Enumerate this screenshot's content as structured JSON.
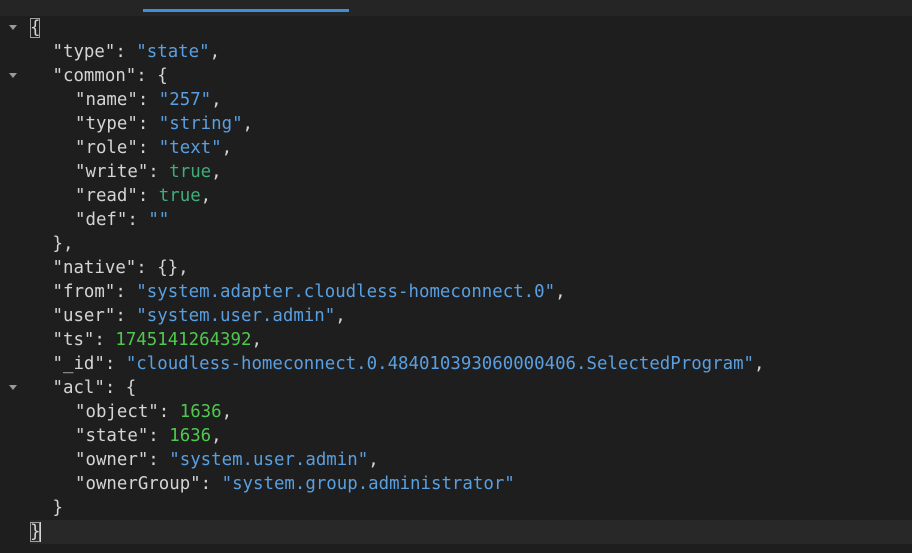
{
  "json_lines": [
    {
      "parts": [
        {
          "t": "{",
          "c": "punc"
        }
      ]
    },
    {
      "indent": 1,
      "parts": [
        {
          "t": "\"type\"",
          "c": "key"
        },
        {
          "t": ": ",
          "c": "punc"
        },
        {
          "t": "\"state\"",
          "c": "str"
        },
        {
          "t": ",",
          "c": "punc"
        }
      ]
    },
    {
      "indent": 1,
      "parts": [
        {
          "t": "\"common\"",
          "c": "key"
        },
        {
          "t": ": {",
          "c": "punc"
        }
      ]
    },
    {
      "indent": 2,
      "parts": [
        {
          "t": "\"name\"",
          "c": "key"
        },
        {
          "t": ": ",
          "c": "punc"
        },
        {
          "t": "\"257\"",
          "c": "str"
        },
        {
          "t": ",",
          "c": "punc"
        }
      ]
    },
    {
      "indent": 2,
      "parts": [
        {
          "t": "\"type\"",
          "c": "key"
        },
        {
          "t": ": ",
          "c": "punc"
        },
        {
          "t": "\"string\"",
          "c": "str"
        },
        {
          "t": ",",
          "c": "punc"
        }
      ]
    },
    {
      "indent": 2,
      "parts": [
        {
          "t": "\"role\"",
          "c": "key"
        },
        {
          "t": ": ",
          "c": "punc"
        },
        {
          "t": "\"text\"",
          "c": "str"
        },
        {
          "t": ",",
          "c": "punc"
        }
      ]
    },
    {
      "indent": 2,
      "parts": [
        {
          "t": "\"write\"",
          "c": "key"
        },
        {
          "t": ": ",
          "c": "punc"
        },
        {
          "t": "true",
          "c": "bool"
        },
        {
          "t": ",",
          "c": "punc"
        }
      ]
    },
    {
      "indent": 2,
      "parts": [
        {
          "t": "\"read\"",
          "c": "key"
        },
        {
          "t": ": ",
          "c": "punc"
        },
        {
          "t": "true",
          "c": "bool"
        },
        {
          "t": ",",
          "c": "punc"
        }
      ]
    },
    {
      "indent": 2,
      "parts": [
        {
          "t": "\"def\"",
          "c": "key"
        },
        {
          "t": ": ",
          "c": "punc"
        },
        {
          "t": "\"\"",
          "c": "str"
        }
      ]
    },
    {
      "indent": 1,
      "parts": [
        {
          "t": "},",
          "c": "punc"
        }
      ]
    },
    {
      "indent": 1,
      "parts": [
        {
          "t": "\"native\"",
          "c": "key"
        },
        {
          "t": ": {},",
          "c": "punc"
        }
      ]
    },
    {
      "indent": 1,
      "parts": [
        {
          "t": "\"from\"",
          "c": "key"
        },
        {
          "t": ": ",
          "c": "punc"
        },
        {
          "t": "\"system.adapter.cloudless-homeconnect.0\"",
          "c": "str"
        },
        {
          "t": ",",
          "c": "punc"
        }
      ]
    },
    {
      "indent": 1,
      "parts": [
        {
          "t": "\"user\"",
          "c": "key"
        },
        {
          "t": ": ",
          "c": "punc"
        },
        {
          "t": "\"system.user.admin\"",
          "c": "str"
        },
        {
          "t": ",",
          "c": "punc"
        }
      ]
    },
    {
      "indent": 1,
      "parts": [
        {
          "t": "\"ts\"",
          "c": "key"
        },
        {
          "t": ": ",
          "c": "punc"
        },
        {
          "t": "1745141264392",
          "c": "num"
        },
        {
          "t": ",",
          "c": "punc"
        }
      ]
    },
    {
      "indent": 1,
      "parts": [
        {
          "t": "\"_id\"",
          "c": "key"
        },
        {
          "t": ": ",
          "c": "punc"
        },
        {
          "t": "\"cloudless-homeconnect.0.484010393060000406.SelectedProgram\"",
          "c": "str"
        },
        {
          "t": ",",
          "c": "punc"
        }
      ]
    },
    {
      "indent": 1,
      "parts": [
        {
          "t": "\"acl\"",
          "c": "key"
        },
        {
          "t": ": {",
          "c": "punc"
        }
      ]
    },
    {
      "indent": 2,
      "parts": [
        {
          "t": "\"object\"",
          "c": "key"
        },
        {
          "t": ": ",
          "c": "punc"
        },
        {
          "t": "1636",
          "c": "num"
        },
        {
          "t": ",",
          "c": "punc"
        }
      ]
    },
    {
      "indent": 2,
      "parts": [
        {
          "t": "\"state\"",
          "c": "key"
        },
        {
          "t": ": ",
          "c": "punc"
        },
        {
          "t": "1636",
          "c": "num"
        },
        {
          "t": ",",
          "c": "punc"
        }
      ]
    },
    {
      "indent": 2,
      "parts": [
        {
          "t": "\"owner\"",
          "c": "key"
        },
        {
          "t": ": ",
          "c": "punc"
        },
        {
          "t": "\"system.user.admin\"",
          "c": "str"
        },
        {
          "t": ",",
          "c": "punc"
        }
      ]
    },
    {
      "indent": 2,
      "parts": [
        {
          "t": "\"ownerGroup\"",
          "c": "key"
        },
        {
          "t": ": ",
          "c": "punc"
        },
        {
          "t": "\"system.group.administrator\"",
          "c": "str"
        }
      ]
    },
    {
      "indent": 1,
      "parts": [
        {
          "t": "}",
          "c": "punc"
        }
      ]
    },
    {
      "parts": [
        {
          "t": "}",
          "c": "punc"
        }
      ]
    }
  ],
  "fold_lines": [
    0,
    2,
    15
  ],
  "brace_match_lines": [
    0,
    21
  ],
  "current_line": 21,
  "colors": {
    "background": "#1e1e1e",
    "tab_strip": "#252526",
    "active_tab_indicator": "#3c8fd8",
    "key": "#d4d4d4",
    "string": "#5a9fe0",
    "number": "#4ec94e",
    "boolean": "#3fae7a"
  },
  "icons": {
    "fold": "chevron-down-icon"
  }
}
